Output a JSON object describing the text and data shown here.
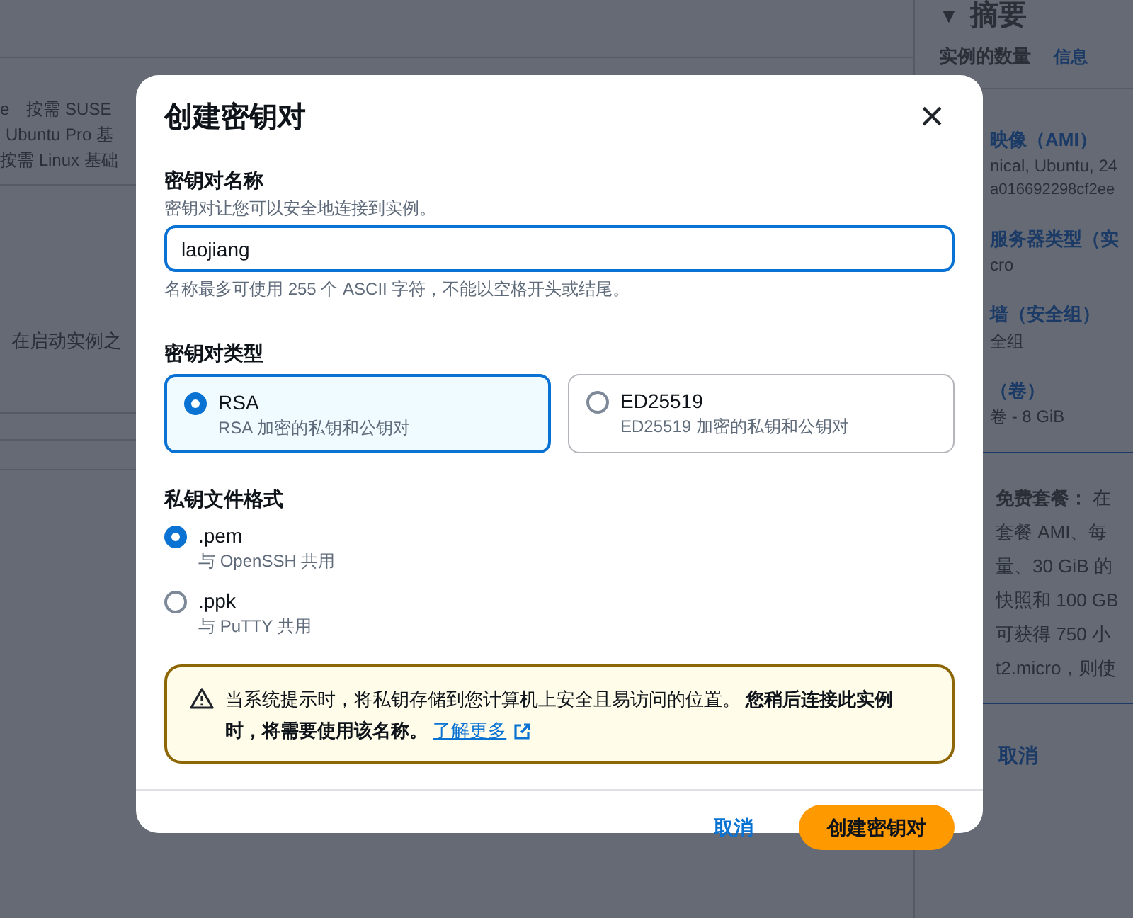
{
  "background": {
    "left_texts": [
      "e",
      "按需 SUSE",
      "Ubuntu Pro 基",
      "按需 Linux 基础",
      "在启动实例之"
    ],
    "summary": {
      "title": "摘要",
      "caret": "▼",
      "count_label": "实例的数量",
      "info_link": "信息",
      "lines": [
        {
          "kind": "heading",
          "text": "映像（AMI）"
        },
        {
          "kind": "value",
          "text": "nical, Ubuntu, 24"
        },
        {
          "kind": "small",
          "text": "a016692298cf2ee"
        },
        {
          "kind": "heading",
          "text": "服务器类型（实"
        },
        {
          "kind": "value",
          "text": "cro"
        },
        {
          "kind": "heading",
          "text": "墙（安全组）"
        },
        {
          "kind": "value",
          "text": "全组"
        },
        {
          "kind": "heading",
          "text": "（卷）"
        },
        {
          "kind": "value",
          "text": "卷 - 8 GiB"
        }
      ],
      "free_tier": [
        "**免费套餐：** 在",
        "套餐 AMI、每",
        "量、30 GiB 的",
        "快照和 100 GB",
        "可获得 750 小",
        "t2.micro，则使"
      ],
      "cancel": "取消"
    }
  },
  "dialog": {
    "title": "创建密钥对",
    "close": "×",
    "name_label": "密钥对名称",
    "name_desc": "密钥对让您可以安全地连接到实例。",
    "name_value": "laojiang",
    "name_hint": "名称最多可使用 255 个 ASCII 字符，不能以空格开头或结尾。",
    "type_label": "密钥对类型",
    "types": [
      {
        "title": "RSA",
        "desc": "RSA 加密的私钥和公钥对",
        "selected": true
      },
      {
        "title": "ED25519",
        "desc": "ED25519 加密的私钥和公钥对",
        "selected": false
      }
    ],
    "format_label": "私钥文件格式",
    "formats": [
      {
        "title": ".pem",
        "desc": "与 OpenSSH 共用",
        "selected": true
      },
      {
        "title": ".ppk",
        "desc": "与 PuTTY 共用",
        "selected": false
      }
    ],
    "alert": {
      "text": "当系统提示时，将私钥存储到您计算机上安全且易访问的位置。 **您稍后连接此实例时，将需要使用该名称。**",
      "link": "了解更多"
    },
    "cancel": "取消",
    "submit": "创建密钥对"
  }
}
